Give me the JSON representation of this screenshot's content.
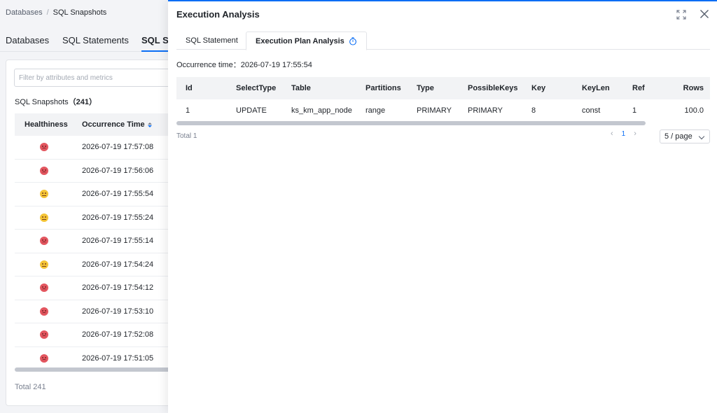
{
  "breadcrumb": {
    "items": [
      "Databases",
      "SQL Snapshots"
    ],
    "separator": "/"
  },
  "main_tabs": [
    {
      "label": "Databases"
    },
    {
      "label": "SQL Statements"
    },
    {
      "label": "SQL Sn"
    }
  ],
  "snapshots": {
    "filter_placeholder": "Filter by attributes and metrics",
    "count_label": "SQL Snapshots",
    "count_value": "（241）",
    "headers": {
      "healthiness": "Healthiness",
      "occurrence_time": "Occurrence Time"
    },
    "rows": [
      {
        "health": "bad",
        "time": "2026-07-19 17:57:08"
      },
      {
        "health": "bad",
        "time": "2026-07-19 17:56:06"
      },
      {
        "health": "warn",
        "time": "2026-07-19 17:55:54"
      },
      {
        "health": "warn",
        "time": "2026-07-19 17:55:24"
      },
      {
        "health": "bad",
        "time": "2026-07-19 17:55:14"
      },
      {
        "health": "warn",
        "time": "2026-07-19 17:54:24"
      },
      {
        "health": "bad",
        "time": "2026-07-19 17:54:12"
      },
      {
        "health": "bad",
        "time": "2026-07-19 17:53:10"
      },
      {
        "health": "bad",
        "time": "2026-07-19 17:52:08"
      },
      {
        "health": "bad",
        "time": "2026-07-19 17:51:05"
      }
    ],
    "total": "Total 241"
  },
  "drawer": {
    "title": "Execution Analysis",
    "tabs": [
      {
        "label": "SQL Statement"
      },
      {
        "label": "Execution Plan Analysis"
      }
    ],
    "occurrence_label": "Occurrence time：",
    "occurrence_value": "2026-07-19 17:55:54",
    "plan": {
      "headers": [
        "Id",
        "SelectType",
        "Table",
        "Partitions",
        "Type",
        "PossibleKeys",
        "Key",
        "KeyLen",
        "Ref",
        "Rows"
      ],
      "rows": [
        [
          "1",
          "UPDATE",
          "ks_km_app_node",
          "range",
          "PRIMARY",
          "PRIMARY",
          "8",
          "const",
          "1",
          "100.0"
        ]
      ]
    },
    "total": "Total 1",
    "pager": {
      "prev": "‹",
      "page": "1",
      "next": "›",
      "page_size": "5 / page"
    }
  },
  "colors": {
    "accent": "#0b6ef5",
    "bad": "#e3565f",
    "warn": "#f4c436"
  }
}
